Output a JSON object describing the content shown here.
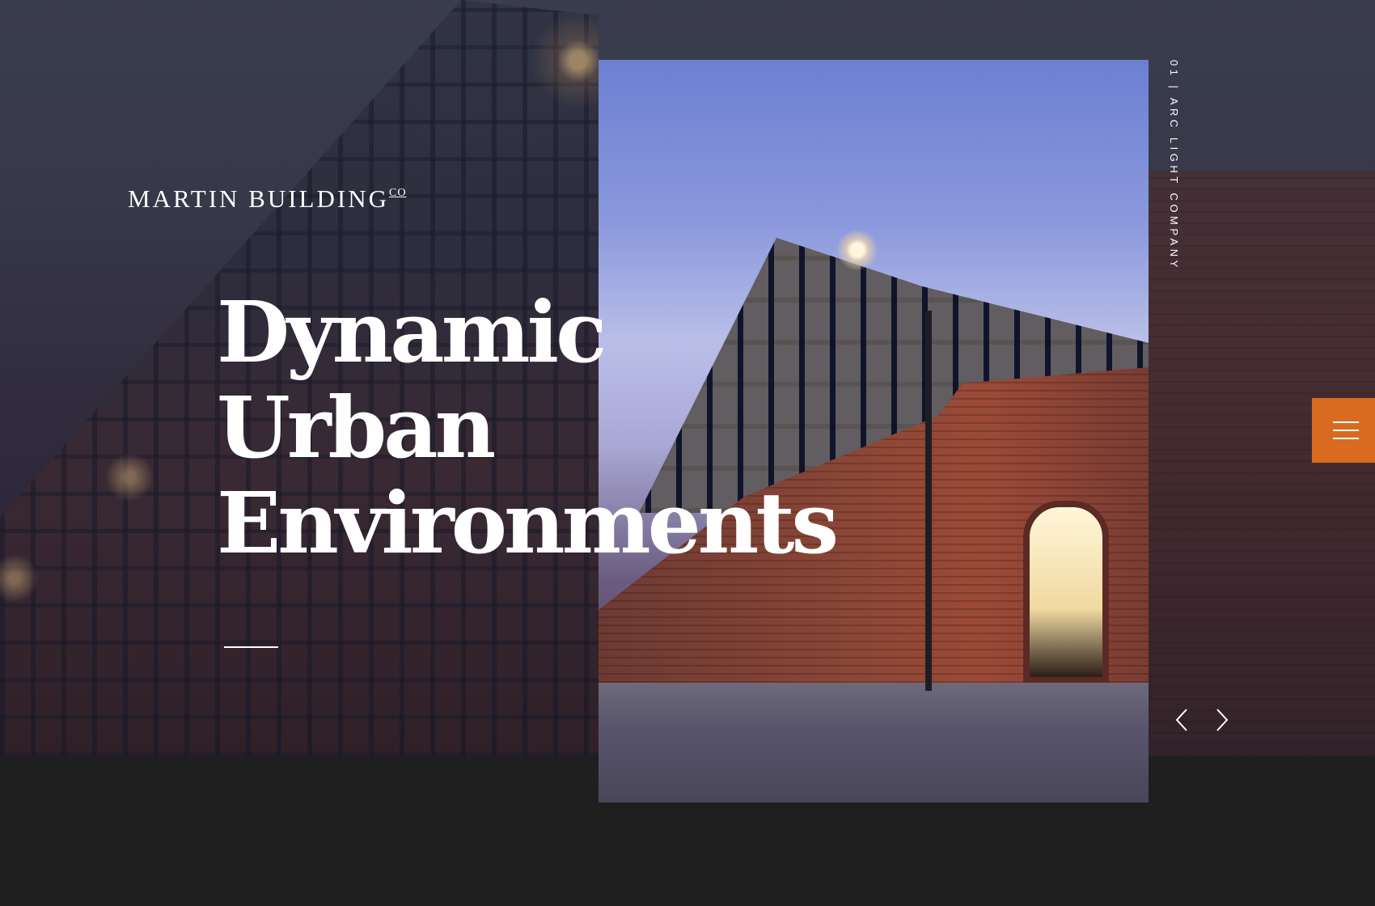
{
  "brand": {
    "name": "MARTIN BUILDING",
    "suffix": "CO"
  },
  "hero": {
    "headline_lines": [
      "Dynamic",
      "Urban",
      "Environments"
    ]
  },
  "slide": {
    "label": "01 | ARC LIGHT COMPANY"
  },
  "controls": {
    "menu_icon": "hamburger-menu-icon",
    "prev_icon": "chevron-left-icon",
    "next_icon": "chevron-right-icon"
  },
  "colors": {
    "accent": "#d96a20",
    "background_dark": "#1f1f20",
    "text": "#ffffff"
  }
}
